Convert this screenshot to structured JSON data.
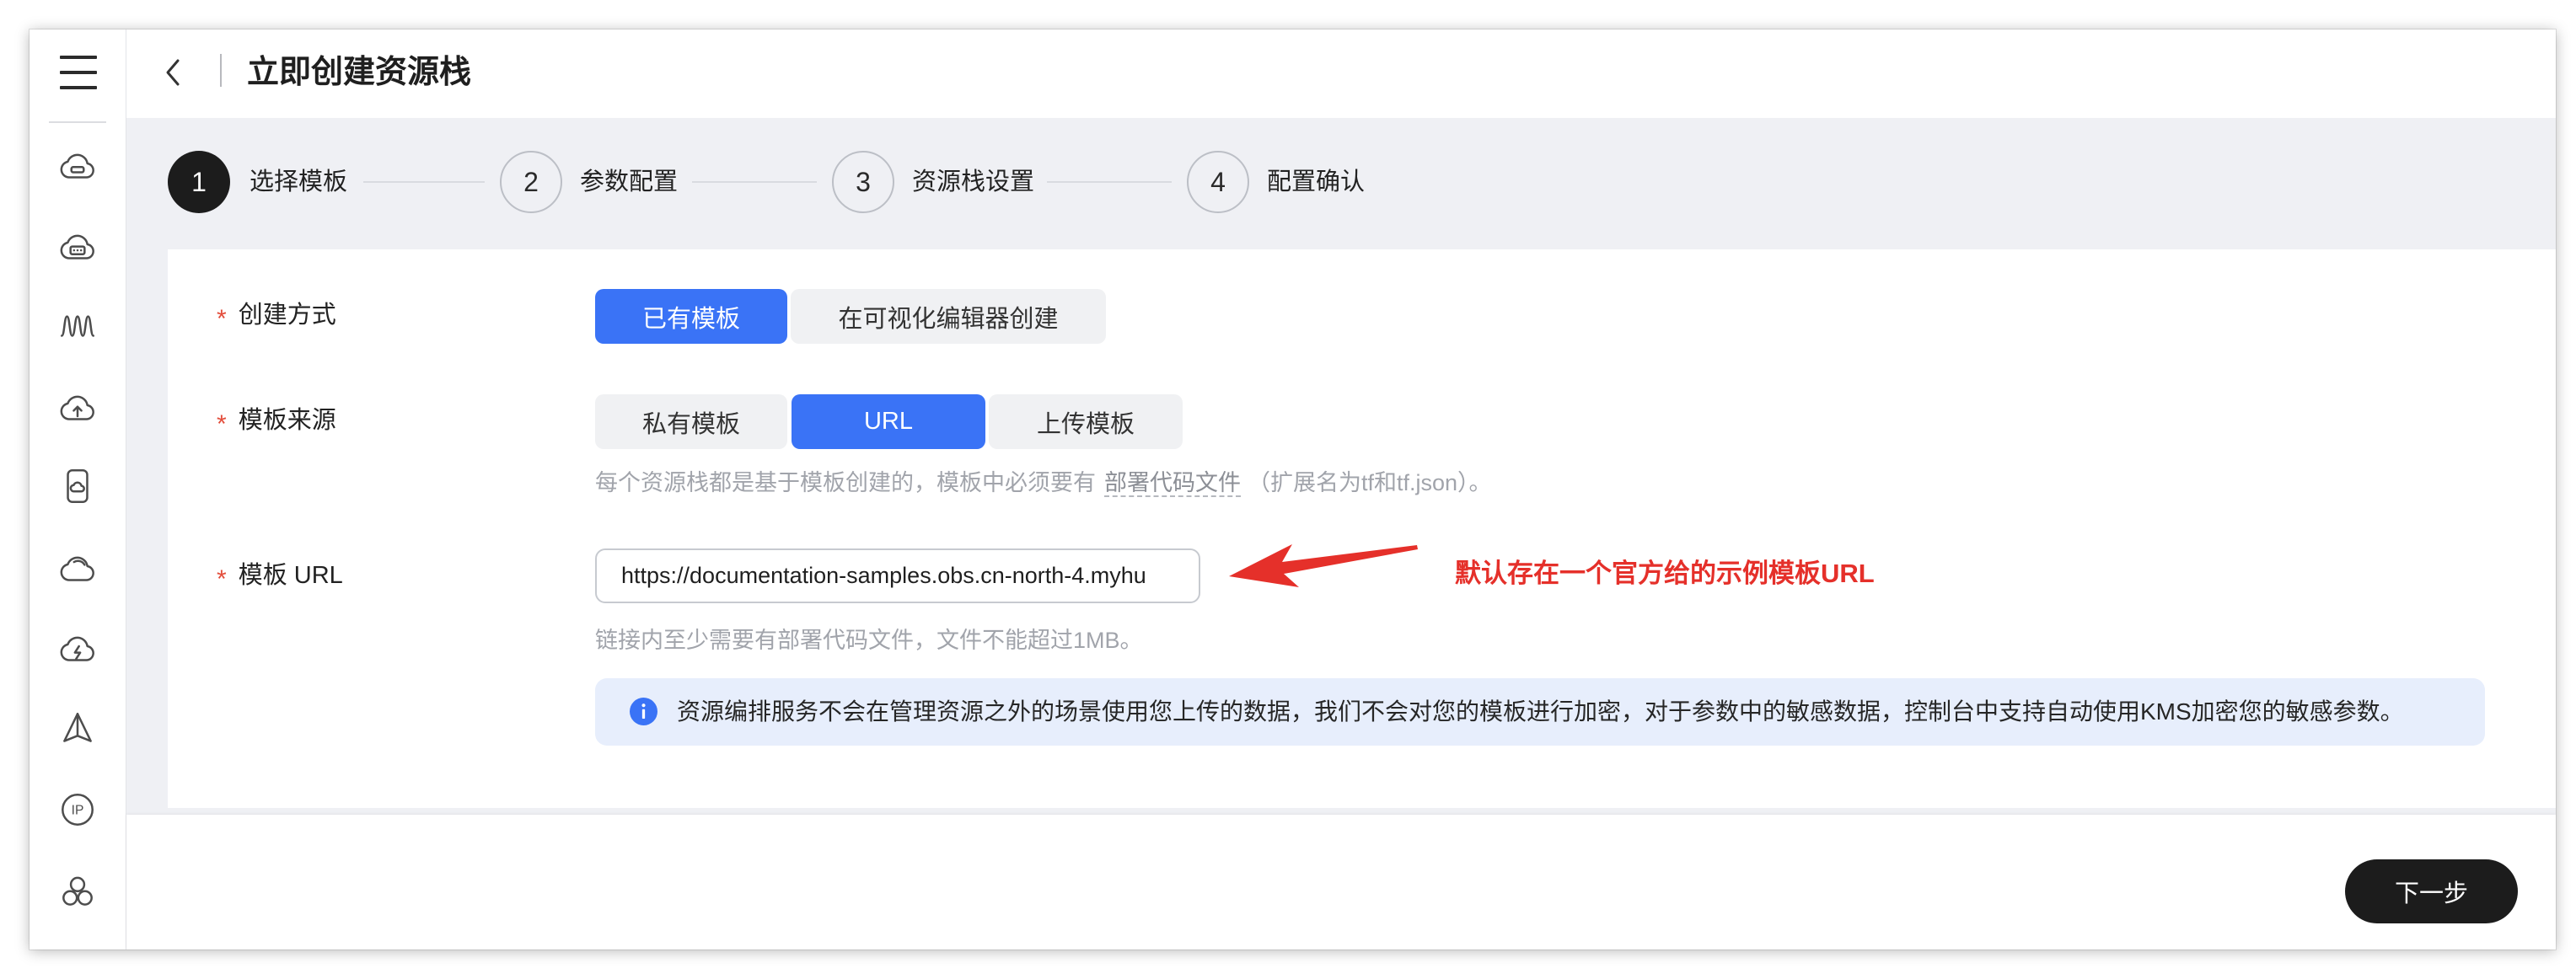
{
  "header": {
    "title": "立即创建资源栈",
    "back_icon": "chevron-left-icon"
  },
  "sidebar": {
    "menu_icon": "hamburger-menu-icon",
    "items": [
      {
        "icon": "cloud-server-icon"
      },
      {
        "icon": "cloud-database-icon"
      },
      {
        "icon": "wave-peaks-icon"
      },
      {
        "icon": "cloud-upload-icon"
      },
      {
        "icon": "mobile-cloud-icon"
      },
      {
        "icon": "cloud-icon"
      },
      {
        "icon": "cloud-function-icon"
      },
      {
        "icon": "pyramid-icon"
      },
      {
        "icon": "ip-icon",
        "text": "IP"
      },
      {
        "icon": "cluster-icon"
      }
    ]
  },
  "stepper": {
    "current": 1,
    "steps": [
      {
        "number": "1",
        "label": "选择模板"
      },
      {
        "number": "2",
        "label": "参数配置"
      },
      {
        "number": "3",
        "label": "资源栈设置"
      },
      {
        "number": "4",
        "label": "配置确认"
      }
    ]
  },
  "form": {
    "required_mark": "*",
    "create_method": {
      "label": "创建方式",
      "options": [
        "已有模板",
        "在可视化编辑器创建"
      ],
      "selected_index": 0
    },
    "template_source": {
      "label": "模板来源",
      "options": [
        "私有模板",
        "URL",
        "上传模板"
      ],
      "selected_index": 1,
      "help_prefix": "每个资源栈都是基于模板创建的，模板中必须要有",
      "help_link": "部署代码文件",
      "help_suffix": "（扩展名为tf和tf.json）。"
    },
    "template_url": {
      "label": "模板 URL",
      "value": "https://documentation-samples.obs.cn-north-4.myhu",
      "help": "链接内至少需要有部署代码文件，文件不能超过1MB。"
    }
  },
  "annotation": {
    "text": "默认存在一个官方给的示例模板URL"
  },
  "info": {
    "icon": "info-icon",
    "text": "资源编排服务不会在管理资源之外的场景使用您上传的数据，我们不会对您的模板进行加密，对于参数中的敏感数据，控制台中支持自动使用KMS加密您的敏感参数。"
  },
  "footer": {
    "next_label": "下一步"
  },
  "colors": {
    "accent": "#3a73f6",
    "annotation_red": "#e5302a",
    "required_red": "#e34d3b",
    "dark": "#1c1c1c",
    "canvas_gray": "#eff0f4",
    "info_bg": "#e7eefc"
  }
}
